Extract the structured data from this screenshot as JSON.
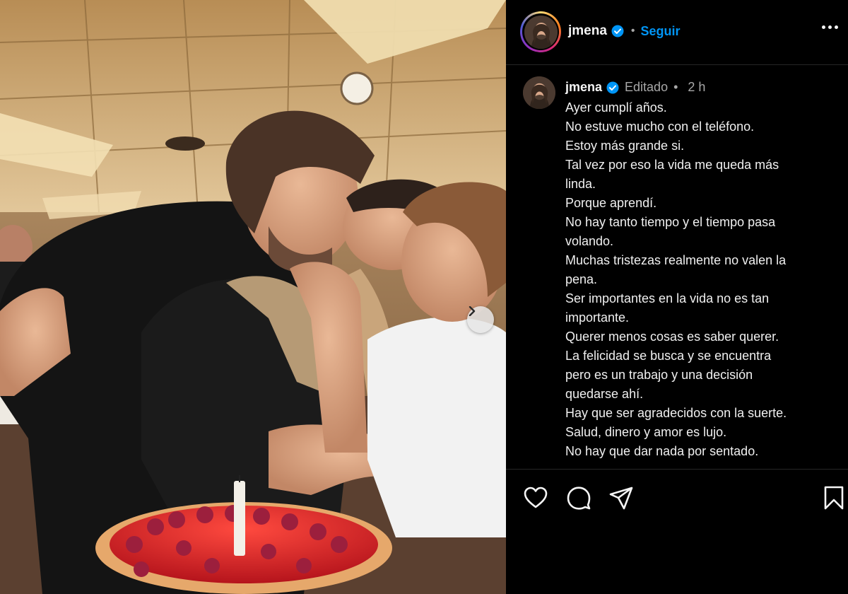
{
  "post": {
    "username": "jmena",
    "follow_label": "Seguir",
    "header_separator": "•",
    "photo": {
      "description_icon": "carousel-next-icon",
      "candle_color": "#f3f0e8",
      "cake_color": "#d8242c"
    }
  },
  "caption": {
    "username": "jmena",
    "edited_label": "Editado",
    "separator": "•",
    "time": "2 h",
    "lines": [
      "Ayer cumplí años.",
      "No estuve mucho con el teléfono.",
      "Estoy más grande si.",
      "Tal vez por eso la vida me queda más",
      "linda.",
      "Porque aprendí.",
      "No hay tanto tiempo y el tiempo pasa",
      "volando.",
      "Muchas tristezas realmente no valen la",
      "pena.",
      "Ser importantes en la vida no es tan",
      "importante.",
      "Querer menos cosas es saber querer.",
      "La felicidad se busca y se encuentra",
      "pero es un trabajo y una decisión",
      "quedarse ahí.",
      "Hay que ser agradecidos con la suerte.",
      "Salud, dinero y amor es lujo.",
      "No hay que dar nada por sentado."
    ]
  },
  "colors": {
    "follow_blue": "#0095f6",
    "verified_blue": "#0095f6",
    "muted_text": "#a8a8a8",
    "background": "#000000"
  },
  "icons": {
    "like": "heart-icon",
    "comment": "comment-icon",
    "share": "send-icon",
    "save": "bookmark-icon",
    "more": "more-options-icon",
    "verified": "verified-badge-icon"
  }
}
